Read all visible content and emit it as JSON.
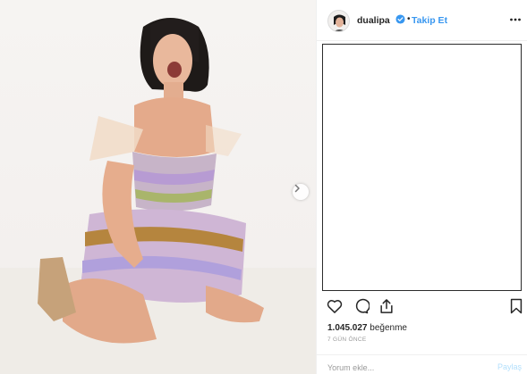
{
  "post": {
    "photo": {
      "image": "woman-sequin-dress-kneeling-photo",
      "next_icon": "chevron-right-icon"
    },
    "header": {
      "avatar": "profile-avatar",
      "username": "dualipa",
      "verified_icon": "verified-badge-icon",
      "separator": "•",
      "follow_label": "Takip Et",
      "more_icon": "more-options-icon"
    },
    "actions": {
      "like_icon": "heart-icon",
      "comment_icon": "comment-bubble-icon",
      "share_icon": "share-icon",
      "save_icon": "bookmark-icon"
    },
    "likes": {
      "count": "1.045.027",
      "label": "beğenme"
    },
    "timestamp": "7 GÜN ÖNCE",
    "comment_bar": {
      "placeholder": "Yorum ekle...",
      "share_label": "Paylaş"
    }
  },
  "colors": {
    "link_blue": "#3897f0",
    "verified_blue": "#3897f0",
    "disabled_share": "#b2dffc",
    "text": "#262626",
    "muted": "#999999",
    "border": "#efefef"
  }
}
